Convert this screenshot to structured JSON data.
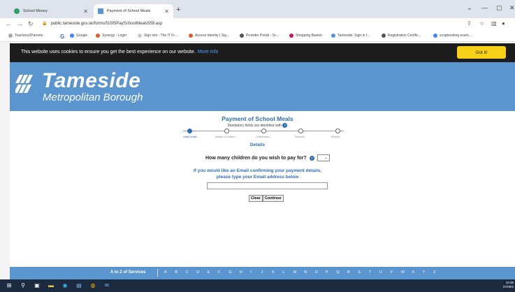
{
  "browser": {
    "tabs": [
      {
        "label": "School Money",
        "active": false
      },
      {
        "label": "Payment of School Meals",
        "active": true
      }
    ],
    "new_tab": "+",
    "url": "public.tameside.gov.uk/forms/f1005PaySchoolMeals559.asp",
    "bookmarks": [
      "Teachers2Parents",
      "G",
      "Google",
      "Synergy - Login",
      "Sign into : The IT Fr...",
      "Access Identity | Sig...",
      "Provider Portal - Sc...",
      "Shopping Basket",
      "Tameside: Sign in t...",
      "Registration Certific...",
      "scopbooking exam..."
    ]
  },
  "cookie_bar": {
    "text": "This website uses cookies to ensure you get the best experience on our website.",
    "link": "More Info",
    "button": "Got it!"
  },
  "header": {
    "name": "Tameside",
    "sub": "Metropolitan Borough"
  },
  "form": {
    "title": "Payment of School Meals",
    "mandatory_note": "Mandatory fields are identified with",
    "help_mark": "?",
    "steps": [
      "Initial Details",
      "Details of Children",
      "Confirmation",
      "Payment",
      "Receipt"
    ],
    "section": "Details",
    "question": "How many children do you wish to pay for?",
    "select_value": "",
    "email_line1": "If you would like an Email confirming your payment details,",
    "email_line2": "please type your Email address below",
    "email_value": "",
    "clear_button": "Clear",
    "continue_button": "Continue"
  },
  "az": {
    "title": "A to Z of Services",
    "letters": [
      "A",
      "B",
      "C",
      "D",
      "E",
      "F",
      "G",
      "H",
      "I",
      "J",
      "K",
      "L",
      "M",
      "N",
      "O",
      "P",
      "Q",
      "R",
      "S",
      "T",
      "U",
      "V",
      "W",
      "X",
      "Y",
      "Z"
    ]
  },
  "taskbar": {
    "time": "10:36",
    "date": "07/09/2"
  },
  "colors": {
    "brand_blue": "#5b95d0",
    "link_blue": "#2e6eb5",
    "cookie_button": "#f7d117"
  }
}
